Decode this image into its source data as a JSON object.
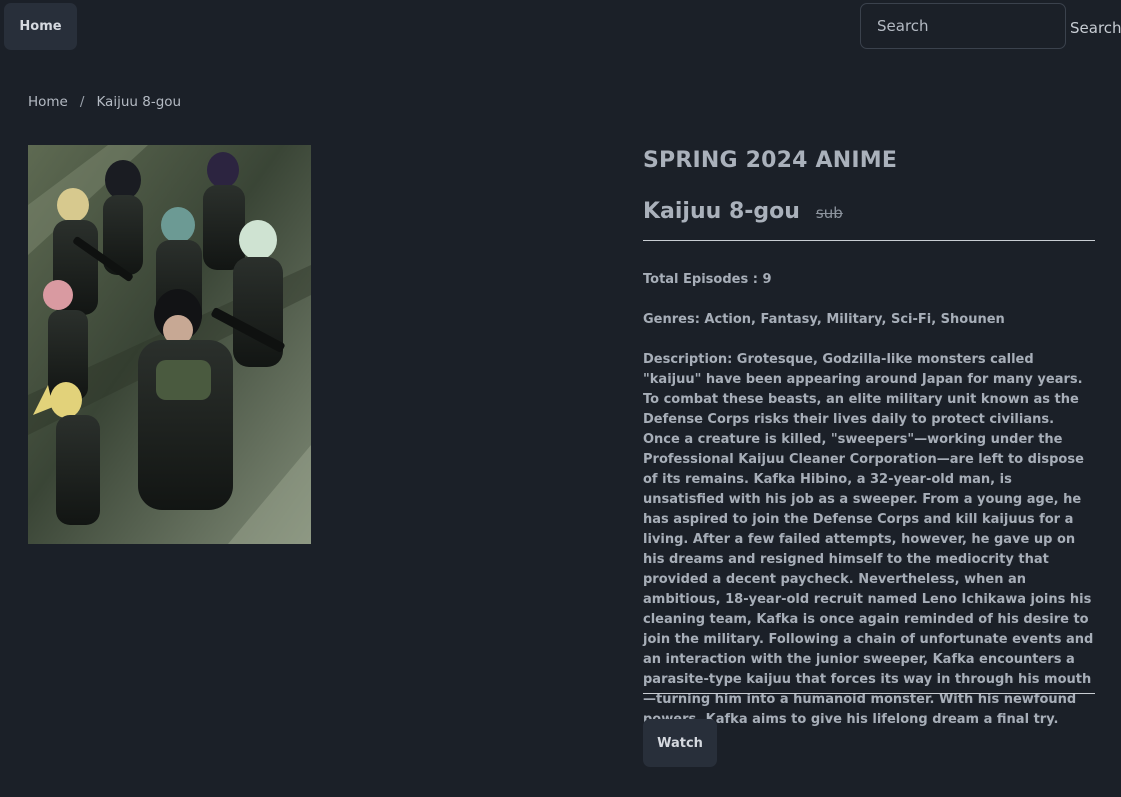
{
  "nav": {
    "home_label": "Home",
    "search_placeholder": "Search",
    "search_button": "Search"
  },
  "breadcrumb": {
    "home": "Home",
    "separator": "/",
    "current": "Kaijuu 8-gou"
  },
  "anime": {
    "season": "SPRING 2024 ANIME",
    "title": "Kaijuu 8-gou",
    "badge": "sub",
    "episodes": "Total Episodes : 9",
    "genres": "Genres: Action, Fantasy, Military, Sci-Fi, Shounen",
    "description": "Description: Grotesque, Godzilla-like monsters called \"kaijuu\" have been appearing around Japan for many years. To combat these beasts, an elite military unit known as the Defense Corps risks their lives daily to protect civilians. Once a creature is killed, \"sweepers\"—working under the Professional Kaijuu Cleaner Corporation—are left to dispose of its remains. Kafka Hibino, a 32-year-old man, is unsatisfied with his job as a sweeper. From a young age, he has aspired to join the Defense Corps and kill kaijuus for a living. After a few failed attempts, however, he gave up on his dreams and resigned himself to the mediocrity that provided a decent paycheck. Nevertheless, when an ambitious, 18-year-old recruit named Leno Ichikawa joins his cleaning team, Kafka is once again reminded of his desire to join the military. Following a chain of unfortunate events and an interaction with the junior sweeper, Kafka encounters a parasite-type kaijuu that forces its way in through his mouth—turning him into a humanoid monster. With his newfound powers, Kafka aims to give his lifelong dream a final try.",
    "watch_label": "Watch"
  },
  "colors": {
    "background": "#1b2028",
    "button": "#282f3a",
    "text": "#b4bac3"
  }
}
